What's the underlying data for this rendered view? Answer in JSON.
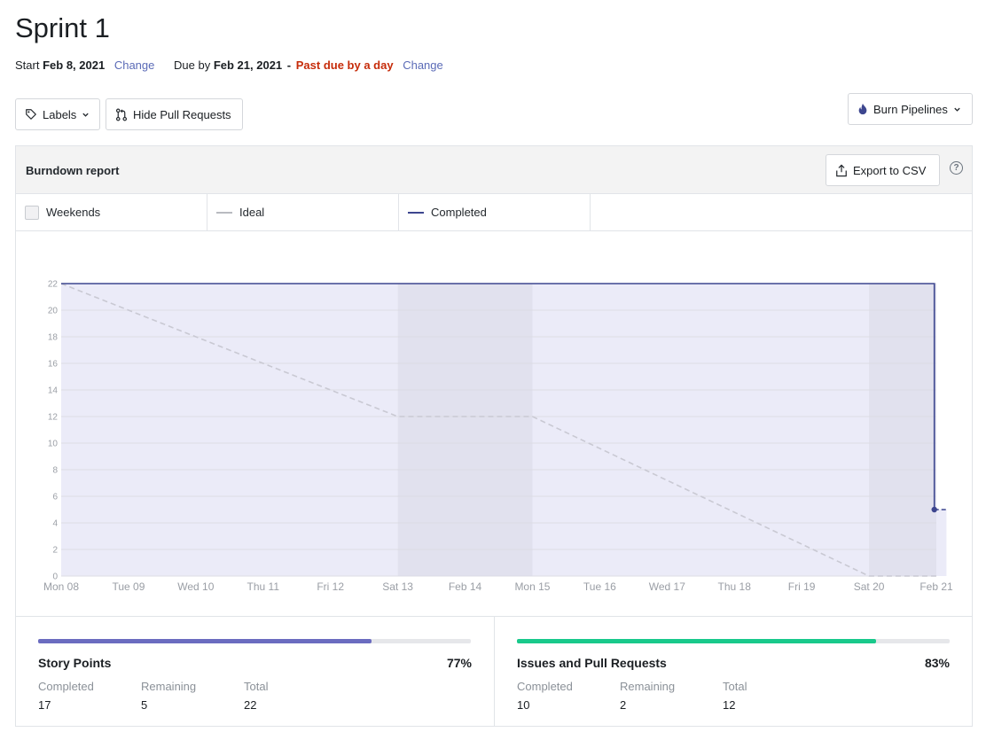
{
  "page": {
    "title": "Sprint 1",
    "start_label": "Start",
    "start_date": "Feb 8, 2021",
    "change_label": "Change",
    "due_label": "Due by",
    "due_date": "Feb 21, 2021",
    "due_separator": "-",
    "past_due_text": "Past due by a day"
  },
  "toolbar": {
    "labels_button": "Labels",
    "hide_pr_button": "Hide Pull Requests",
    "burn_button": "Burn Pipelines"
  },
  "report": {
    "title": "Burndown report",
    "export_button": "Export to CSV",
    "help_glyph": "?"
  },
  "legend": [
    {
      "label": "Weekends"
    },
    {
      "label": "Ideal",
      "color": "#b9bbc0"
    },
    {
      "label": "Completed",
      "color": "#3d468f"
    }
  ],
  "colors": {
    "completed_line": "#3d468f",
    "ideal_line": "#c9c9d3",
    "area_fill": "#ebebf8",
    "weekend_fill": "#e1e1ee",
    "story_bar": "#6b6cc0",
    "issues_bar": "#19c98b",
    "past_due": "#c62c0a",
    "link": "#5b6bb7"
  },
  "chart_data": {
    "type": "line",
    "x": [
      "Mon 08",
      "Tue 09",
      "Wed 10",
      "Thu 11",
      "Fri 12",
      "Sat 13",
      "Feb 14",
      "Mon 15",
      "Tue 16",
      "Wed 17",
      "Thu 18",
      "Fri 19",
      "Sat 20",
      "Feb 21"
    ],
    "ylim": [
      0,
      22
    ],
    "yticks": [
      0,
      2,
      4,
      6,
      8,
      10,
      12,
      14,
      16,
      18,
      20,
      22
    ],
    "weekends": [
      [
        5,
        7
      ],
      [
        12,
        13
      ]
    ],
    "series": [
      {
        "name": "Ideal",
        "points": [
          [
            0,
            22
          ],
          [
            5,
            12
          ],
          [
            7,
            12
          ],
          [
            12,
            0
          ],
          [
            13,
            0
          ]
        ]
      },
      {
        "name": "Completed",
        "points": [
          [
            0,
            22
          ],
          [
            12.97,
            22
          ],
          [
            12.97,
            5
          ],
          [
            13.15,
            5
          ]
        ]
      }
    ],
    "grid": true
  },
  "stats": [
    {
      "title": "Story Points",
      "percent_label": "77%",
      "progress": 0.77,
      "completed_label": "Completed",
      "completed": "17",
      "remaining_label": "Remaining",
      "remaining": "5",
      "total_label": "Total",
      "total": "22"
    },
    {
      "title": "Issues and Pull Requests",
      "percent_label": "83%",
      "progress": 0.83,
      "completed_label": "Completed",
      "completed": "10",
      "remaining_label": "Remaining",
      "remaining": "2",
      "total_label": "Total",
      "total": "12"
    }
  ]
}
